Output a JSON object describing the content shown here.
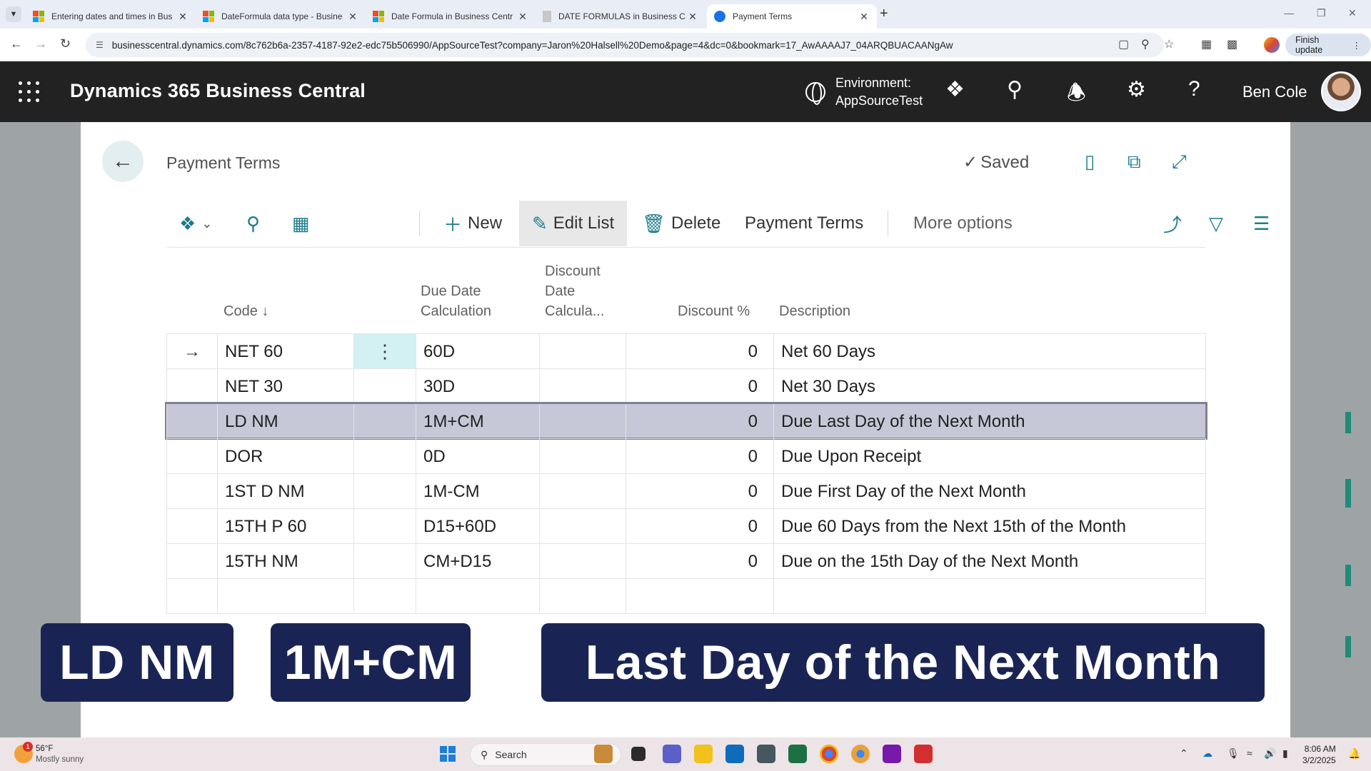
{
  "browser": {
    "tabs": [
      {
        "title": "Entering dates and times in Bus",
        "active": false
      },
      {
        "title": "DateFormula data type - Busine",
        "active": false
      },
      {
        "title": "Date Formula in Business Centr",
        "active": false
      },
      {
        "title": "DATE FORMULAS in Business C",
        "active": false
      },
      {
        "title": "Payment Terms",
        "active": true
      }
    ],
    "new_tab": "+",
    "url": "businesscentral.dynamics.com/8c762b6a-2357-4187-92e2-edc75b506990/AppSourceTest?company=Jaron%20Halsell%20Demo&page=4&dc=0&bookmark=17_AwAAAAJ7_04ARQBUACAANgAw",
    "finish_update": "Finish update"
  },
  "app_header": {
    "title": "Dynamics 365 Business Central",
    "environment_label": "Environment:",
    "environment_value": "AppSourceTest",
    "user_name": "Ben Cole"
  },
  "page": {
    "title": "Payment Terms",
    "saved_label": "Saved",
    "actions": {
      "new": "New",
      "edit_list": "Edit List",
      "delete": "Delete",
      "payment_terms": "Payment Terms",
      "more_options": "More options"
    }
  },
  "grid": {
    "columns": {
      "code": "Code ↓",
      "due_date_line1": "Due Date",
      "due_date_line2": "Calculation",
      "discount_date_line1": "Discount",
      "discount_date_line2": "Date",
      "discount_date_line3": "Calcula...",
      "discount_pct": "Discount %",
      "description": "Description"
    },
    "rows": [
      {
        "code": "NET 60",
        "due": "60D",
        "disc_date": "",
        "disc_pct": "0",
        "desc": "Net 60 Days"
      },
      {
        "code": "NET 30",
        "due": "30D",
        "disc_date": "",
        "disc_pct": "0",
        "desc": "Net 30 Days"
      },
      {
        "code": "LD NM",
        "due": "1M+CM",
        "disc_date": "",
        "disc_pct": "0",
        "desc": "Due Last Day of the Next Month"
      },
      {
        "code": "DOR",
        "due": "0D",
        "disc_date": "",
        "disc_pct": "0",
        "desc": "Due Upon Receipt"
      },
      {
        "code": "1ST D NM",
        "due": "1M-CM",
        "disc_date": "",
        "disc_pct": "0",
        "desc": "Due First Day of the Next Month"
      },
      {
        "code": "15TH P 60",
        "due": "D15+60D",
        "disc_date": "",
        "disc_pct": "0",
        "desc": "Due 60 Days from the Next 15th of the Month"
      },
      {
        "code": "15TH NM",
        "due": "CM+D15",
        "disc_date": "",
        "disc_pct": "0",
        "desc": "Due on the 15th Day of the Next Month"
      }
    ]
  },
  "overlay": {
    "code": "LD NM",
    "formula": "1M+CM",
    "meaning": "Last Day of the Next Month"
  },
  "taskbar": {
    "temperature": "56°F",
    "weather": "Mostly sunny",
    "weather_badge": "1",
    "search": "Search",
    "time": "8:06 AM",
    "date": "3/2/2025"
  },
  "colors": {
    "header_bg": "#222222",
    "accent": "#1c7c8c",
    "selected_row": "#c6c8d7",
    "callout_bg": "#1a2454"
  }
}
